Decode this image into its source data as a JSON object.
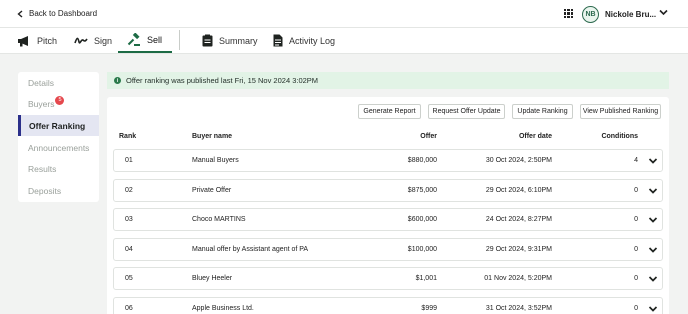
{
  "topbar": {
    "back_label": "Back to Dashboard",
    "avatar_initials": "NB",
    "user_name": "Nickole Bru..."
  },
  "tabs": [
    {
      "label": "Pitch",
      "icon": "megaphone-icon"
    },
    {
      "label": "Sign",
      "icon": "signature-icon"
    },
    {
      "label": "Sell",
      "icon": "gavel-icon",
      "active": true
    },
    {
      "label": "Summary",
      "icon": "clipboard-icon"
    },
    {
      "label": "Activity Log",
      "icon": "document-icon"
    }
  ],
  "sidebar": {
    "items": [
      {
        "label": "Details"
      },
      {
        "label": "Buyers",
        "badge": "5"
      },
      {
        "label": "Offer Ranking",
        "active": true
      },
      {
        "label": "Announcements"
      },
      {
        "label": "Results"
      },
      {
        "label": "Deposits"
      }
    ]
  },
  "banner": {
    "text": "Offer ranking was published last Fri, 15 Nov 2024 3:02PM"
  },
  "actions": {
    "generate_report": "Generate Report",
    "request_update": "Request Offer Update",
    "update_ranking": "Update Ranking",
    "view_published": "View Published Ranking"
  },
  "table": {
    "headers": {
      "rank": "Rank",
      "buyer": "Buyer name",
      "offer": "Offer",
      "date": "Offer date",
      "conditions": "Conditions"
    },
    "rows": [
      {
        "rank": "01",
        "buyer": "Manual Buyers",
        "offer": "$880,000",
        "date": "30 Oct 2024, 2:50PM",
        "conditions": "4"
      },
      {
        "rank": "02",
        "buyer": "Private Offer",
        "offer": "$875,000",
        "date": "29 Oct 2024, 6:10PM",
        "conditions": "0"
      },
      {
        "rank": "03",
        "buyer": "Choco MARTINS",
        "offer": "$600,000",
        "date": "24 Oct 2024, 8:27PM",
        "conditions": "0"
      },
      {
        "rank": "04",
        "buyer": "Manual offer by Assistant agent of PA",
        "offer": "$100,000",
        "date": "29 Oct 2024, 9:31PM",
        "conditions": "0"
      },
      {
        "rank": "05",
        "buyer": "Bluey Heeler",
        "offer": "$1,001",
        "date": "01 Nov 2024, 5:20PM",
        "conditions": "0"
      },
      {
        "rank": "06",
        "buyer": "Apple Business Ltd.",
        "offer": "$999",
        "date": "31 Oct 2024, 3:52PM",
        "conditions": "0"
      }
    ]
  },
  "colors": {
    "accent_green": "#1d6b45",
    "sidebar_active": "#2b2f8a",
    "banner_bg": "#e2f3e6",
    "badge_red": "#e5484d"
  }
}
